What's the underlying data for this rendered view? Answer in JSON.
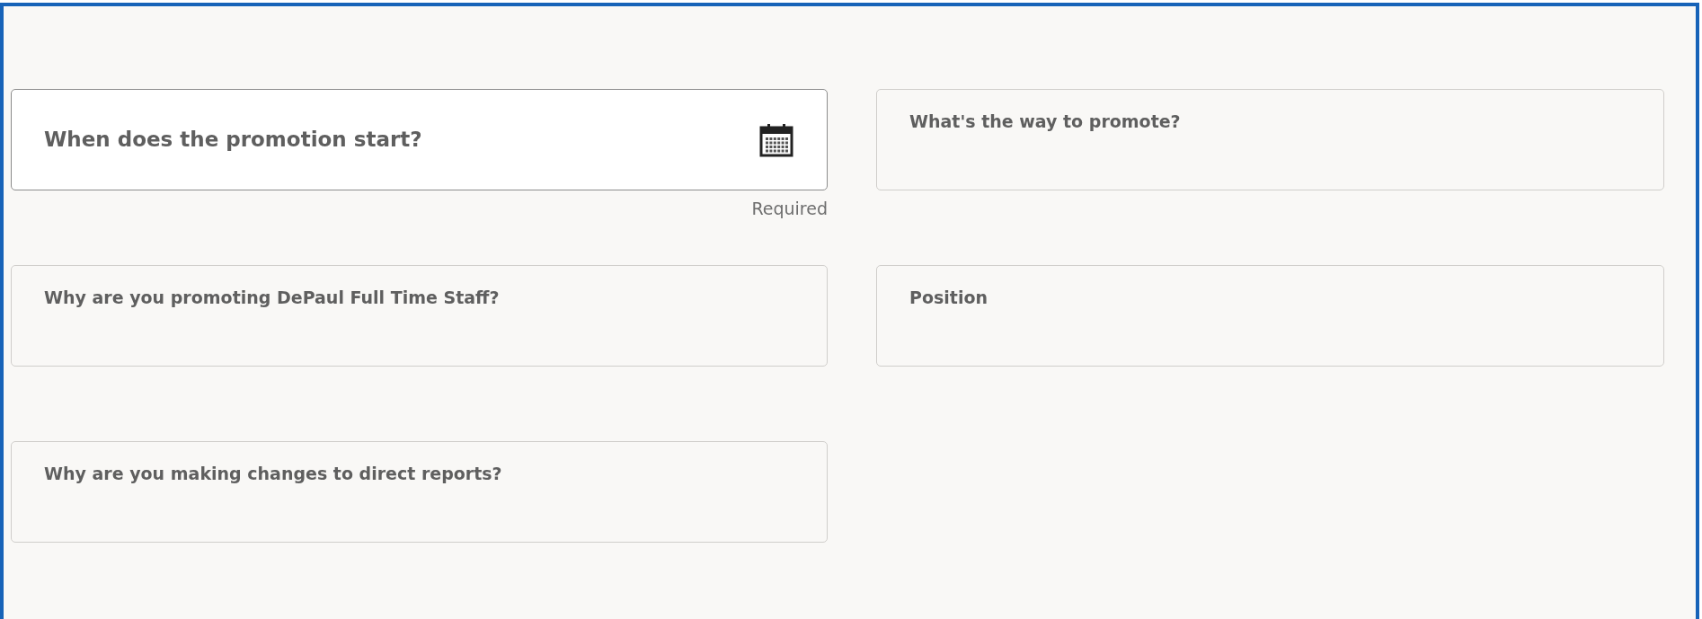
{
  "rows": [
    {
      "fields": [
        {
          "label": "When does the promotion start?",
          "kind": "date",
          "focused": true,
          "hint": "Required"
        },
        {
          "label": "What's the way to promote?",
          "kind": "text",
          "focused": false
        }
      ]
    },
    {
      "fields": [
        {
          "label": "Why are you promoting DePaul Full Time Staff?",
          "kind": "text",
          "focused": false
        },
        {
          "label": "Position",
          "kind": "text",
          "focused": false
        }
      ]
    },
    {
      "fields": [
        {
          "label": "Why are you making changes to direct reports?",
          "kind": "text",
          "focused": false
        }
      ]
    }
  ]
}
